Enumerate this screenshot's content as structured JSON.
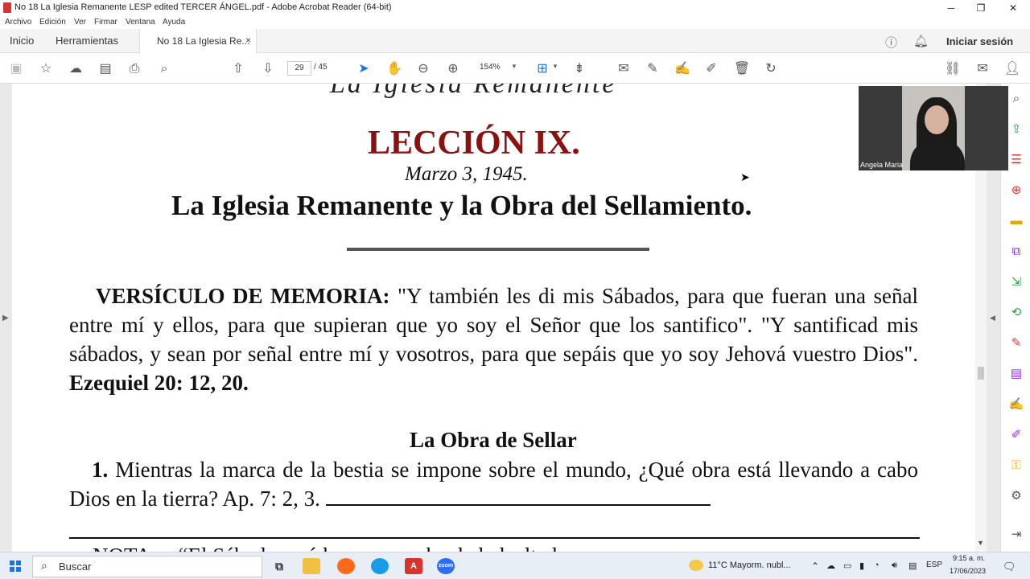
{
  "window": {
    "title": "No 18 La Iglesia Remanente LESP edited TERCER ÁNGEL.pdf - Adobe Acrobat Reader (64-bit)",
    "minimize": "─",
    "maximize": "❐",
    "close": "✕"
  },
  "menu": [
    "Archivo",
    "Edición",
    "Ver",
    "Firmar",
    "Ventana",
    "Ayuda"
  ],
  "tabs": {
    "home": "Inicio",
    "tools": "Herramientas",
    "document": "No 18 La Iglesia Re...",
    "close": "×",
    "signin": "Iniciar sesión"
  },
  "toolbar": {
    "current_page": "29",
    "total_pages": "/ 45",
    "zoom": "154%"
  },
  "document": {
    "header_partial": "La Iglesia Remanente",
    "lesson": "LECCIÓN IX.",
    "date": "Marzo 3, 1945.",
    "title": "La Iglesia Remanente y la Obra del Sellamiento.",
    "memory_label": "VERSÍCULO DE MEMORIA:",
    "memory_text": " \"Y también les di mis Sábados, para que fueran una señal entre mí y ellos, para que supieran que yo soy el Señor que los santifico\". \"Y santificad mis sábados, y sean por señal entre mí y vosotros, para que sepáis que yo soy Jehová vuestro Dios\". ",
    "memory_ref": "Ezequiel 20: 12, 20.",
    "section": "La Obra de Sellar",
    "q1_num": "1.",
    "q1_text": " Mientras la marca de la bestia se impone sobre el mundo, ¿Qué obra está llevando a cabo Dios en la tierra? Ap. 7: 2, 3. ",
    "note_partial": "NOTA.—“El Sábado será la gran prueba de la lealtad…"
  },
  "video": {
    "participant": "Angela Maria"
  },
  "taskbar": {
    "search_placeholder": "Buscar",
    "weather": "11°C  Mayorm. nubl...",
    "lang": "ESP",
    "time": "9:15 a. m.",
    "date": "17/06/2023",
    "zoom_label": "zoom"
  },
  "colors": {
    "lesson_red": "#8b1010",
    "accent_blue": "#1a73e8",
    "tool_purple": "#8a2be2",
    "tool_red": "#d9342b",
    "tool_green": "#2e9d3f"
  }
}
